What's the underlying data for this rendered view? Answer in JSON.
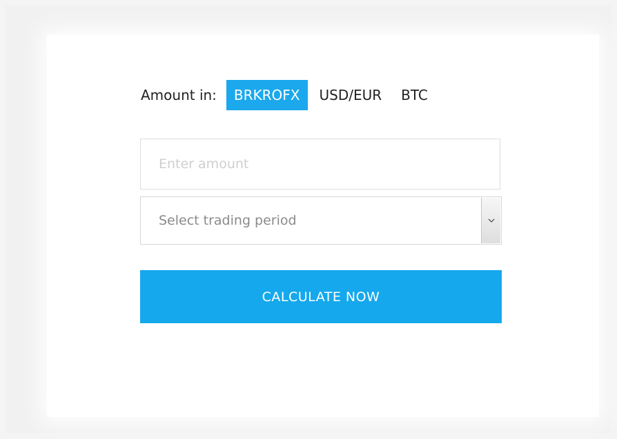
{
  "currency_selector": {
    "label": "Amount in:",
    "options": [
      {
        "label": "BRKROFX",
        "active": true
      },
      {
        "label": "USD/EUR",
        "active": false
      },
      {
        "label": "BTC",
        "active": false
      }
    ]
  },
  "amount_input": {
    "placeholder": "Enter amount",
    "value": ""
  },
  "period_select": {
    "selected": "Select trading period",
    "arrow_icon": "chevron-down-icon"
  },
  "calculate_button": {
    "label": "CALCULATE NOW"
  },
  "colors": {
    "accent": "#15a8ec",
    "background": "#f1f1f1",
    "card": "#ffffff"
  }
}
